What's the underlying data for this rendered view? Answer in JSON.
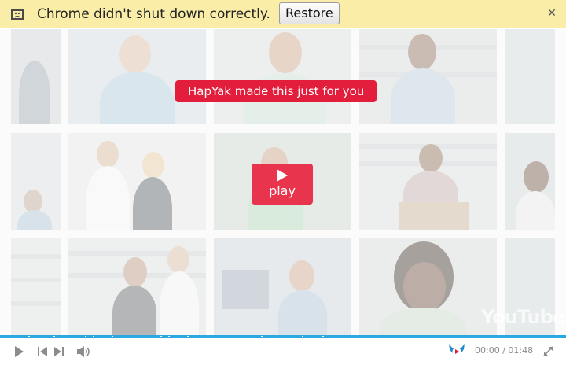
{
  "infobar": {
    "message": "Chrome didn't shut down correctly.",
    "restore_label": "Restore",
    "close_glyph": "✕",
    "icon": "crashed-page-icon"
  },
  "video": {
    "banner_text": "HapYak made this just for you",
    "play_label": "play",
    "watermark": "YouTube",
    "colors": {
      "banner": "#e21e3c",
      "play": "#e8344c",
      "progress": "#29a9e0"
    }
  },
  "controls": {
    "current_time": "00:00",
    "separator": "/",
    "duration": "01:48",
    "icons": [
      "play-icon",
      "previous-icon",
      "next-icon",
      "volume-icon",
      "hapyak-logo-icon",
      "fullscreen-icon"
    ],
    "progress": 1.0
  }
}
